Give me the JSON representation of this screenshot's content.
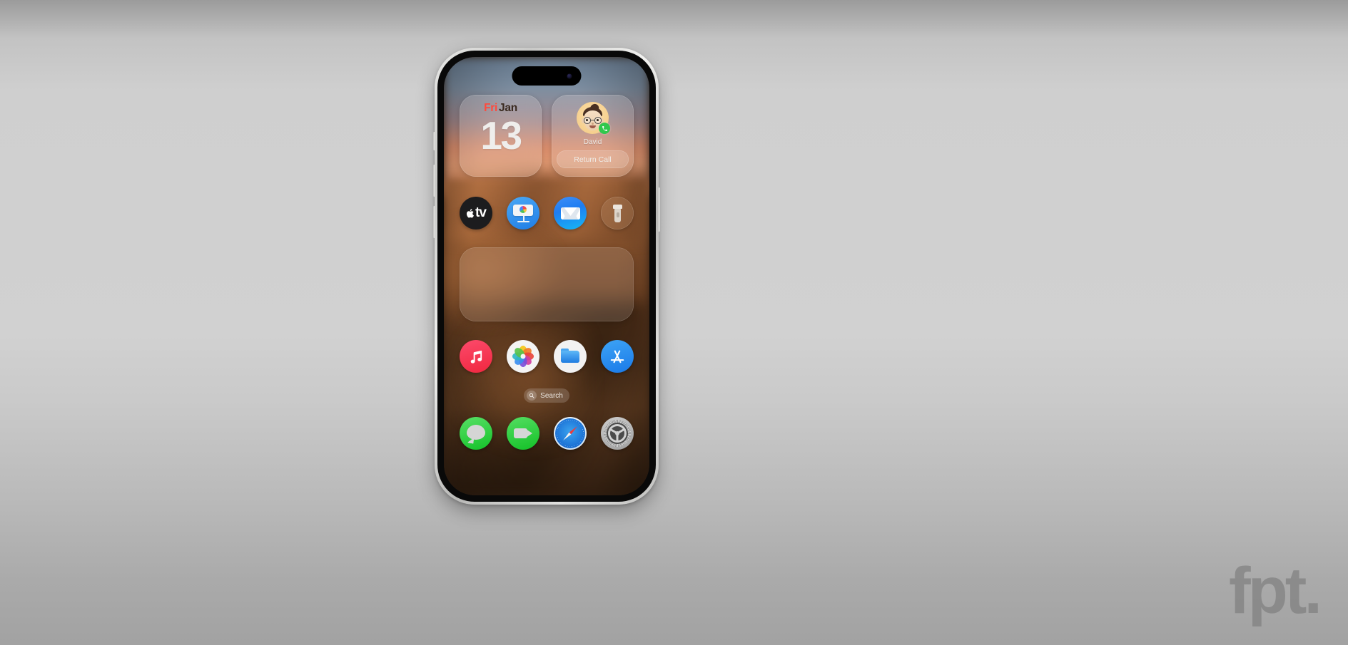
{
  "device": {
    "name": "iPhone",
    "dynamic_island": "dynamic-island",
    "buttons": [
      "action-button",
      "volume-up-button",
      "volume-down-button",
      "power-button"
    ]
  },
  "widgets": {
    "calendar": {
      "weekday": "Fri",
      "month": "Jan",
      "day": "13",
      "weekday_color": "#ff4a3d",
      "month_color": "#3a2a20",
      "day_color": "#efeeec"
    },
    "contact": {
      "name": "David",
      "action_label": "Return Call",
      "avatar": "memoji-avatar",
      "status_badge": "phone-call-badge",
      "badge_color": "#31c84d"
    },
    "empty": {
      "label": ""
    }
  },
  "app_rows": [
    {
      "row_name": "app-row-1",
      "apps": [
        {
          "name": "Apple TV",
          "id": "appletv",
          "icon": "appletv-icon"
        },
        {
          "name": "Keynote",
          "id": "keynote",
          "icon": "keynote-icon"
        },
        {
          "name": "Mail",
          "id": "mail",
          "icon": "mail-icon"
        },
        {
          "name": "Flashlight",
          "id": "flashlight",
          "icon": "flashlight-icon"
        }
      ]
    },
    {
      "row_name": "app-row-2",
      "apps": [
        {
          "name": "Music",
          "id": "music",
          "icon": "music-icon"
        },
        {
          "name": "Photos",
          "id": "photos",
          "icon": "photos-icon"
        },
        {
          "name": "Files",
          "id": "files",
          "icon": "files-icon"
        },
        {
          "name": "App Store",
          "id": "appstore",
          "icon": "appstore-icon"
        }
      ]
    }
  ],
  "search": {
    "label": "Search",
    "icon": "search-icon"
  },
  "dock": {
    "apps": [
      {
        "name": "Messages",
        "id": "messages",
        "icon": "messages-icon"
      },
      {
        "name": "FaceTime",
        "id": "facetime",
        "icon": "facetime-icon"
      },
      {
        "name": "Safari",
        "id": "safari",
        "icon": "safari-icon"
      },
      {
        "name": "Settings",
        "id": "settings",
        "icon": "settings-icon"
      }
    ]
  },
  "watermark": {
    "text": "fpt.",
    "color": "#808080"
  },
  "wallpaper": {
    "description": "desert dunes at sunset",
    "sky_color": "#6b7f95",
    "sunset_color": "#d98b6a",
    "ground_color": "#7b4a28"
  }
}
